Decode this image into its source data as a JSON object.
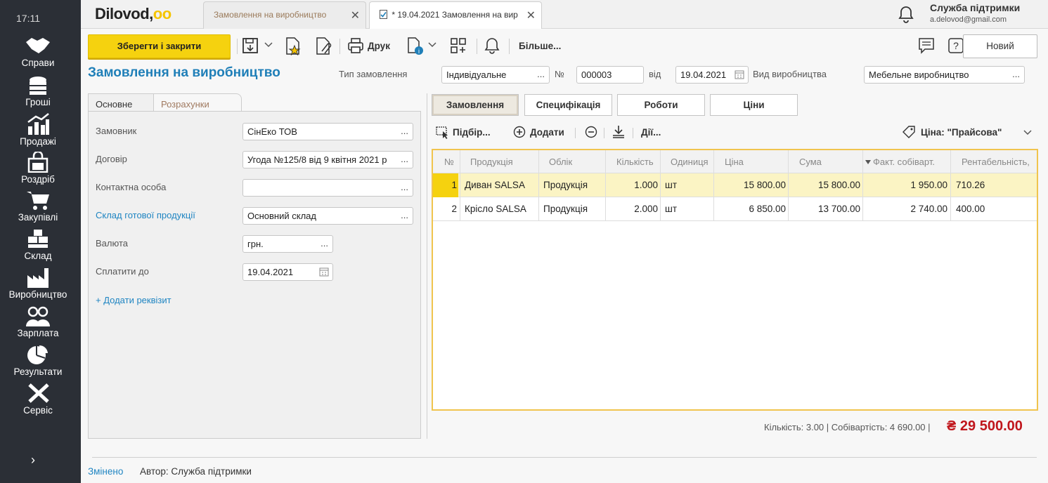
{
  "sidebar": {
    "clock": "17:11",
    "items": [
      {
        "label": "Справи",
        "icon": "handshake-icon"
      },
      {
        "label": "Гроші",
        "icon": "coins-icon"
      },
      {
        "label": "Продажі",
        "icon": "bar-chart-icon"
      },
      {
        "label": "Роздріб",
        "icon": "shopping-bag-icon"
      },
      {
        "label": "Закупівлі",
        "icon": "cart-icon"
      },
      {
        "label": "Склад",
        "icon": "boxes-icon"
      },
      {
        "label": "Виробництво",
        "icon": "factory-icon"
      },
      {
        "label": "Зарплата",
        "icon": "people-icon"
      },
      {
        "label": "Результати",
        "icon": "pie-chart-icon"
      },
      {
        "label": "Сервіс",
        "icon": "tools-icon"
      }
    ],
    "expand_glyph": "›"
  },
  "header": {
    "logo": "Dilovod,",
    "logo_dots": "oo",
    "tabs": [
      {
        "label": "Замовлення на виробництво",
        "close": "✕"
      },
      {
        "label": "* 19.04.2021 Замовлення на вир",
        "close": "✕"
      }
    ],
    "support_name": "Служба підтримки",
    "support_email": "a.delovod@gmail.com"
  },
  "toolbar": {
    "save_close": "Зберегти і закрити",
    "print": "Друк",
    "more": "Більше...",
    "new": "Новий"
  },
  "document": {
    "title": "Замовлення на виробництво",
    "order_type_label": "Тип замовлення",
    "order_type": "Індивідуальне",
    "number_label": "№",
    "number": "000003",
    "date_label": "від",
    "date": "19.04.2021",
    "production_type_label": "Вид виробництва",
    "production_type": "Мебельне виробництво"
  },
  "left_tabs": [
    "Основне",
    "Розрахунки"
  ],
  "form": {
    "customer_label": "Замовник",
    "customer": "СінЕко ТОВ",
    "contract_label": "Договір",
    "contract": "Угода №125/8 від 9 квітня 2021 р",
    "contact_label": "Контактна особа",
    "contact": "",
    "warehouse_label": "Склад готової продукції",
    "warehouse": "Основний склад",
    "currency_label": "Валюта",
    "currency": "грн.",
    "pay_until_label": "Сплатити до",
    "pay_until": "19.04.2021",
    "add_attr": "+ Додати реквізит",
    "ellipsis": "..."
  },
  "right_tabs": [
    "Замовлення",
    "Специфікація",
    "Роботи",
    "Ціни"
  ],
  "actions": {
    "pick": "Підбір...",
    "add": "Додати",
    "actions": "Дії...",
    "price": "Ціна: \"Прайсова\""
  },
  "table": {
    "columns": [
      "№",
      "Продукція",
      "Облік",
      "Кількість",
      "Одиниця",
      "Ціна",
      "Сума",
      "Факт. собіварт.",
      "Рентабельність,"
    ],
    "rows": [
      {
        "n": "1",
        "product": "Диван SALSA",
        "account": "Продукція",
        "qty": "1.000",
        "unit": "шт",
        "price": "15 800.00",
        "sum": "15 800.00",
        "cost": "1 950.00",
        "margin": "710.26"
      },
      {
        "n": "2",
        "product": "Крісло SALSA",
        "account": "Продукція",
        "qty": "2.000",
        "unit": "шт",
        "price": "6 850.00",
        "sum": "13 700.00",
        "cost": "2 740.00",
        "margin": "400.00"
      }
    ]
  },
  "totals": {
    "summary": "Кількість: 3.00 | Собівартість: 4 690.00 |",
    "total": "₴ 29 500.00"
  },
  "status": {
    "changed": "Змінено",
    "author": "Автор: Служба підтримки"
  }
}
